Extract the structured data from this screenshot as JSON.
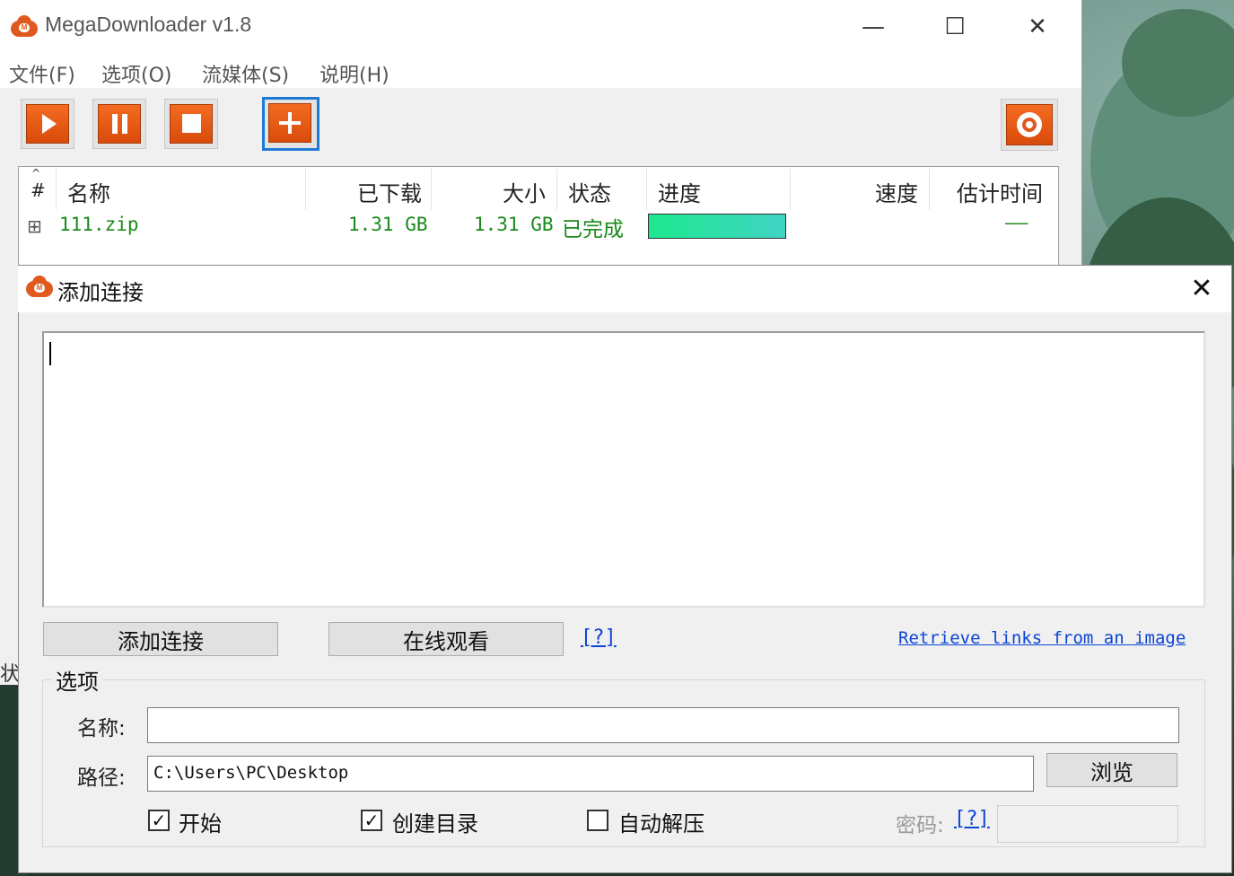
{
  "window": {
    "title": "MegaDownloader v1.8",
    "icon": "mega-cloud-icon",
    "minimize_symbol": "—",
    "maximize_symbol": "☐",
    "close_symbol": "✕"
  },
  "menu": {
    "items": [
      "文件(F)",
      "选项(O)",
      "流媒体(S)",
      "说明(H)"
    ]
  },
  "toolbar": {
    "buttons": [
      {
        "name": "play",
        "icon": "play-icon"
      },
      {
        "name": "pause",
        "icon": "pause-icon"
      },
      {
        "name": "stop",
        "icon": "stop-icon"
      },
      {
        "name": "add",
        "icon": "plus-icon",
        "selected": true
      }
    ],
    "settings_icon": "gear-icon"
  },
  "download_list": {
    "columns": [
      "#",
      "名称",
      "已下载",
      "大小",
      "状态",
      "进度",
      "速度",
      "估计时间"
    ],
    "rows": [
      {
        "expander": "⊞",
        "name": "111.zip",
        "downloaded": "1.31 GB",
        "size": "1.31 GB",
        "status": "已完成",
        "progress": 1.0,
        "speed": "",
        "eta": "——"
      }
    ]
  },
  "status_bar_fragment": "状",
  "add_link_dialog": {
    "title": "添加连接",
    "close_symbol": "✕",
    "links_text": "",
    "add_button": "添加连接",
    "watch_online_button": "在线观看",
    "help_link": "[?]",
    "retrieve_link": "Retrieve links from an image",
    "options": {
      "group_label": "选项",
      "name_label": "名称:",
      "name_value": "",
      "path_label": "路径:",
      "path_value": "C:\\Users\\PC\\Desktop",
      "browse_button": "浏览",
      "start_label": "开始",
      "start_checked": true,
      "create_dir_label": "创建目录",
      "create_dir_checked": true,
      "auto_extract_label": "自动解压",
      "auto_extract_checked": false,
      "password_label": "密码:",
      "password_help": "[?]",
      "password_value": ""
    }
  },
  "colors": {
    "accent_orange": "#e05a1f",
    "status_green": "#1a8a1a",
    "link_blue": "#0b44d6",
    "progress_start": "#1ee88e",
    "progress_end": "#3fd4c4"
  }
}
